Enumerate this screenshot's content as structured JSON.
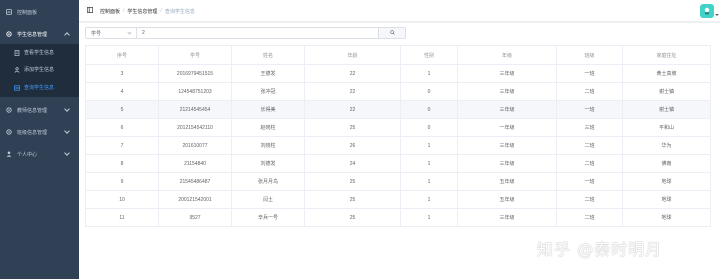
{
  "sidebar": {
    "items": [
      {
        "label": "控制面板",
        "icon": "dashboard-icon"
      },
      {
        "label": "学生信息管理",
        "icon": "gear-icon",
        "expanded": true,
        "children": [
          {
            "label": "查看学生信息",
            "icon": "document-icon"
          },
          {
            "label": "添加学生信息",
            "icon": "add-user-icon"
          },
          {
            "label": "查询学生信息",
            "icon": "search-list-icon",
            "active": true
          }
        ]
      },
      {
        "label": "教师信息管理",
        "icon": "gear-icon"
      },
      {
        "label": "班级信息管理",
        "icon": "gear-icon"
      },
      {
        "label": "个人中心",
        "icon": "user-icon"
      }
    ]
  },
  "header": {
    "breadcrumb": [
      "控制面板",
      "学生信息管理",
      "查询学生信息"
    ]
  },
  "search": {
    "field": "学号",
    "value": "2"
  },
  "table": {
    "headers": [
      "序号",
      "学号",
      "姓名",
      "年龄",
      "性别",
      "年级",
      "班级",
      "家庭住址"
    ],
    "rows": [
      [
        "3",
        "2016979451515",
        "王德发",
        "22",
        "1",
        "三年级",
        "一班",
        "黄土高坡"
      ],
      [
        "4",
        "124548751203",
        "张冲冠",
        "22",
        "0",
        "三年级",
        "二班",
        "谢士镇"
      ],
      [
        "5",
        "21214545454",
        "长得美",
        "22",
        "0",
        "三年级",
        "一班",
        "谢士镇"
      ],
      [
        "6",
        "2012154542110",
        "赵晓柱",
        "25",
        "0",
        "一年级",
        "三班",
        "平和山"
      ],
      [
        "7",
        "201610077",
        "刘晓柱",
        "26",
        "1",
        "三年级",
        "二班",
        "华为"
      ],
      [
        "8",
        "21154840",
        "刘德发",
        "24",
        "1",
        "三年级",
        "二班",
        "佛南"
      ],
      [
        "9",
        "21545486487",
        "张月月鸟",
        "25",
        "1",
        "五年级",
        "一班",
        "地球"
      ],
      [
        "10",
        "200121542001",
        "闫土",
        "25",
        "1",
        "五年级",
        "二班",
        "地球"
      ],
      [
        "11",
        "9527",
        "辛兵一号",
        "25",
        "1",
        "三年级",
        "二班",
        "地球"
      ]
    ],
    "highlighted_row": 2
  },
  "watermark": "知乎 @秦时明月",
  "colors": {
    "sidebar_bg": "#304156",
    "submenu_bg": "#1f2d3d",
    "active": "#409eff",
    "avatar": "#42d3c8"
  }
}
